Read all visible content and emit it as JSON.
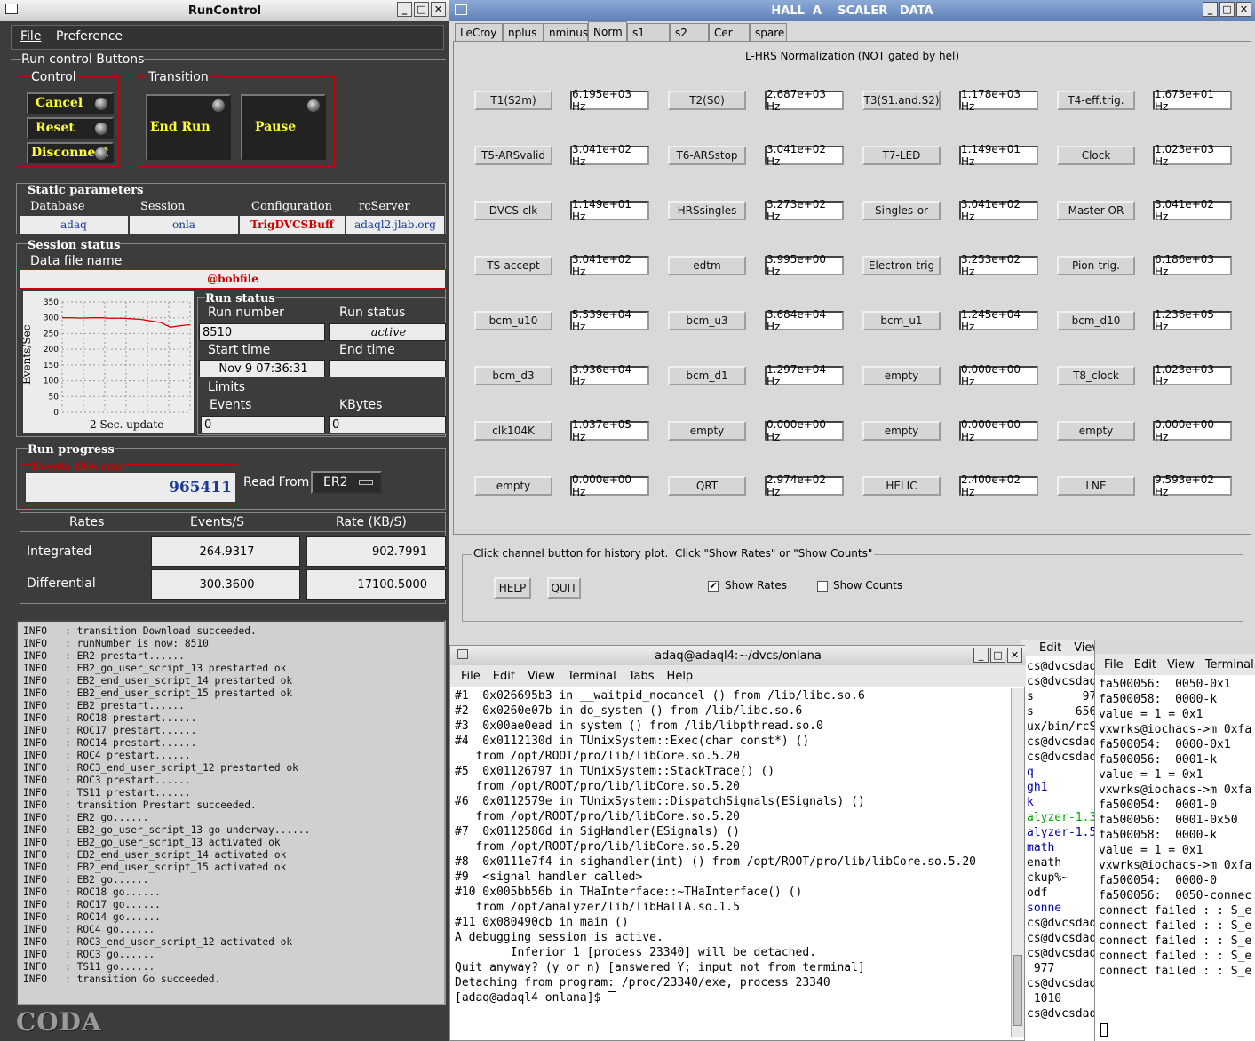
{
  "runcontrol": {
    "title": "RunControl",
    "menu": [
      "File",
      "Preference"
    ],
    "buttons_group": "Run control Buttons",
    "control_label": "Control",
    "control_buttons": [
      "Cancel",
      "Reset",
      "Disconnect"
    ],
    "transition_label": "Transition",
    "transition_buttons": [
      "End Run",
      "Pause"
    ],
    "static_params": {
      "title": "Static parameters",
      "headers": [
        "Database",
        "Session",
        "Configuration",
        "rcServer"
      ],
      "values": [
        "adaq",
        "onla",
        "TrigDVCSBuff",
        "adaql2.jlab.org"
      ]
    },
    "session_status": {
      "title": "Session status",
      "data_file_label": "Data file name",
      "data_file": "@bobfile"
    },
    "graph": {
      "ylabel": "Events/Sec",
      "yticks": [
        "350",
        "300",
        "250",
        "200",
        "150",
        "100",
        "50",
        "0"
      ],
      "caption": "2 Sec. update"
    },
    "run_status": {
      "title": "Run status",
      "run_number_label": "Run number",
      "run_number": "8510",
      "status_label": "Run status",
      "status": "active",
      "start_label": "Start time",
      "start": "Nov 9 07:36:31",
      "end_label": "End time",
      "end": ""
    },
    "limits": {
      "title": "Limits",
      "events_label": "Events",
      "events": "0",
      "kbytes_label": "KBytes",
      "kbytes": "0"
    },
    "progress": {
      "title": "Run progress",
      "events_label": "Events this run",
      "events": "965411",
      "read_from_label": "Read From:",
      "read_from": "ER2"
    },
    "rates": {
      "headers": [
        "Rates",
        "Events/S",
        "Rate (KB/S)"
      ],
      "rows": [
        {
          "label": "Integrated",
          "events": "264.9317",
          "rate": "902.7991"
        },
        {
          "label": "Differential",
          "events": "300.3600",
          "rate": "17100.5000"
        }
      ]
    },
    "log": [
      "INFO   : transition Download succeeded.",
      "INFO   : runNumber is now: 8510",
      "INFO   : ER2 prestart......",
      "INFO   : EB2_go_user_script_13 prestarted ok",
      "INFO   : EB2_end_user_script_14 prestarted ok",
      "INFO   : EB2_end_user_script_15 prestarted ok",
      "INFO   : EB2 prestart......",
      "INFO   : ROC18 prestart......",
      "INFO   : ROC17 prestart......",
      "INFO   : ROC14 prestart......",
      "INFO   : ROC4 prestart......",
      "INFO   : ROC3_end_user_script_12 prestarted ok",
      "INFO   : ROC3 prestart......",
      "INFO   : TS11 prestart......",
      "INFO   : transition Prestart succeeded.",
      "INFO   : ER2 go......",
      "INFO   : EB2_go_user_script_13 go underway......",
      "INFO   : EB2_go_user_script_13 activated ok",
      "INFO   : EB2_end_user_script_14 activated ok",
      "INFO   : EB2_end_user_script_15 activated ok",
      "INFO   : EB2 go......",
      "INFO   : ROC18 go......",
      "INFO   : ROC17 go......",
      "INFO   : ROC14 go......",
      "INFO   : ROC4 go......",
      "INFO   : ROC3_end_user_script_12 activated ok",
      "INFO   : ROC3 go......",
      "INFO   : TS11 go......",
      "INFO   : transition Go succeeded."
    ],
    "logo": "CODA"
  },
  "scaler": {
    "title": "HALL  A    SCALER   DATA",
    "tabs": [
      "LeCroy",
      "nplus",
      "nminus",
      "Norm",
      "s1",
      "s2",
      "Cer",
      "spare"
    ],
    "active_tab": "Norm",
    "heading": "L-HRS Normalization (NOT gated by hel)",
    "channels": [
      [
        "T1(S2m)",
        "6.195e+03 Hz",
        "T2(S0)",
        "2.687e+03 Hz",
        "T3(S1.and.S2)",
        "1.178e+03 Hz",
        "T4-eff.trig.",
        "1.673e+01 Hz"
      ],
      [
        "T5-ARSvalid",
        "3.041e+02 Hz",
        "T6-ARSstop",
        "3.041e+02 Hz",
        "T7-LED",
        "1.149e+01 Hz",
        "Clock",
        "1.023e+03 Hz"
      ],
      [
        "DVCS-clk",
        "1.149e+01 Hz",
        "HRSsingles",
        "3.273e+02 Hz",
        "Singles-or",
        "3.041e+02 Hz",
        "Master-OR",
        "3.041e+02 Hz"
      ],
      [
        "TS-accept",
        "3.041e+02 Hz",
        "edtm",
        "3.995e+00 Hz",
        "Electron-trig",
        "3.253e+02 Hz",
        "Pion-trig.",
        "6.186e+03 Hz"
      ],
      [
        "bcm_u10",
        "5.539e+04 Hz",
        "bcm_u3",
        "3.684e+04 Hz",
        "bcm_u1",
        "1.245e+04 Hz",
        "bcm_d10",
        "1.236e+05 Hz"
      ],
      [
        "bcm_d3",
        "3.936e+04 Hz",
        "bcm_d1",
        "1.297e+04 Hz",
        "empty",
        "0.000e+00 Hz",
        "T8_clock",
        "1.023e+03 Hz"
      ],
      [
        "clk104K",
        "1.037e+05 Hz",
        "empty",
        "0.000e+00 Hz",
        "empty",
        "0.000e+00 Hz",
        "empty",
        "0.000e+00 Hz"
      ],
      [
        "empty",
        "0.000e+00 Hz",
        "QRT",
        "2.974e+02 Hz",
        "HELIC",
        "2.400e+02 Hz",
        "LNE",
        "9.593e+02 Hz"
      ]
    ],
    "footer_legend": "Click channel button for history plot.  Click \"Show Rates\" or \"Show Counts\"",
    "help": "HELP",
    "quit": "QUIT",
    "show_rates": "Show Rates",
    "show_counts": "Show Counts"
  },
  "terminal": {
    "title": "adaq@adaql4:~/dvcs/onlana",
    "menu": [
      "File",
      "Edit",
      "View",
      "Terminal",
      "Tabs",
      "Help"
    ],
    "lines": [
      "#1  0x026695b3 in __waitpid_nocancel () from /lib/libc.so.6",
      "#2  0x0260e07b in do_system () from /lib/libc.so.6",
      "#3  0x00ae0ead in system () from /lib/libpthread.so.0",
      "#4  0x0112130d in TUnixSystem::Exec(char const*) ()",
      "   from /opt/ROOT/pro/lib/libCore.so.5.20",
      "#5  0x01126797 in TUnixSystem::StackTrace() ()",
      "   from /opt/ROOT/pro/lib/libCore.so.5.20",
      "#6  0x0112579e in TUnixSystem::DispatchSignals(ESignals) ()",
      "   from /opt/ROOT/pro/lib/libCore.so.5.20",
      "#7  0x0112586d in SigHandler(ESignals) ()",
      "   from /opt/ROOT/pro/lib/libCore.so.5.20",
      "#8  0x0111e7f4 in sighandler(int) () from /opt/ROOT/pro/lib/libCore.so.5.20",
      "#9  <signal handler called>",
      "#10 0x005bb56b in THaInterface::~THaInterface() ()",
      "   from /opt/analyzer/lib/libHallA.so.1.5",
      "#11 0x080490cb in main ()",
      "A debugging session is active.",
      "",
      "        Inferior 1 [process 23340] will be detached.",
      "",
      "Quit anyway? (y or n) [answered Y; input not from terminal]",
      "Detaching from program: /proc/23340/exe, process 23340",
      "[adaq@adaql4 onlana]$ "
    ]
  },
  "term_mid": {
    "menu": [
      "Edit",
      "View"
    ],
    "lines": [
      {
        "t": "cs@dvcsdaq",
        "c": "#000"
      },
      {
        "t": "cs@dvcsdaq",
        "c": "#000"
      },
      {
        "t": "s       97",
        "c": "#000"
      },
      {
        "t": "s      656",
        "c": "#000"
      },
      {
        "t": "ux/bin/rcS",
        "c": "#000"
      },
      {
        "t": "cs@dvcsdaq",
        "c": "#000"
      },
      {
        "t": "cs@dvcsdaq",
        "c": "#000"
      },
      {
        "t": "q",
        "c": "#00a"
      },
      {
        "t": "gh1",
        "c": "#00a"
      },
      {
        "t": "k",
        "c": "#00a"
      },
      {
        "t": "alyzer-1.3.",
        "c": "#0a0"
      },
      {
        "t": "alyzer-1.5.",
        "c": "#00a"
      },
      {
        "t": "math",
        "c": "#00a"
      },
      {
        "t": "enath",
        "c": "#000"
      },
      {
        "t": "ckup%~",
        "c": "#000"
      },
      {
        "t": "odf",
        "c": "#000"
      },
      {
        "t": "sonne",
        "c": "#00a"
      },
      {
        "t": "cs@dvcsdaq",
        "c": "#000"
      },
      {
        "t": "cs@dvcsdaq",
        "c": "#000"
      },
      {
        "t": "cs@dvcsdaq",
        "c": "#000"
      },
      {
        "t": " 977",
        "c": "#000"
      },
      {
        "t": "cs@dvcsdaq",
        "c": "#000"
      },
      {
        "t": " 1010",
        "c": "#000"
      },
      {
        "t": "cs@dvcsdaq",
        "c": "#000"
      }
    ]
  },
  "term_right": {
    "menu": [
      "File",
      "Edit",
      "View",
      "Terminal"
    ],
    "lines": [
      "fa500056:  0050-0x1",
      "fa500058:  0000-k",
      "",
      "value = 1 = 0x1",
      "vxwrks@iochacs->m 0xfa",
      "fa500054:  0000-0x1",
      "fa500056:  0001-k",
      "",
      "value = 1 = 0x1",
      "vxwrks@iochacs->m 0xfa",
      "fa500054:  0001-0",
      "fa500056:  0001-0x50",
      "fa500058:  0000-k",
      "",
      "value = 1 = 0x1",
      "vxwrks@iochacs->m 0xfa",
      "fa500054:  0000-0",
      "fa500056:  0050-connec",
      "connect failed : : S_e",
      "connect failed : : S_e",
      "connect failed : : S_e",
      "connect failed : : S_e",
      "connect failed : : S_e"
    ]
  },
  "graph_series": [
    300,
    300,
    299,
    300,
    300,
    298,
    299,
    297,
    295,
    290,
    285,
    270,
    275,
    278
  ]
}
